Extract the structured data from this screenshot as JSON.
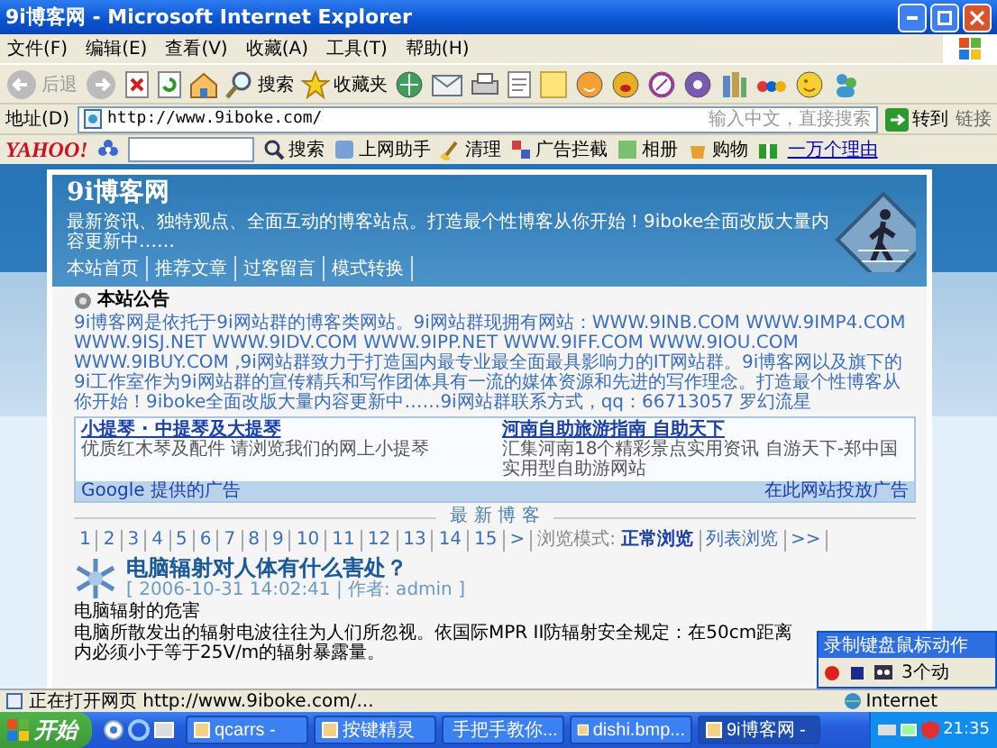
{
  "window": {
    "title": "9i博客网 - Microsoft Internet Explorer"
  },
  "menu": [
    "文件(F)",
    "编辑(E)",
    "查看(V)",
    "收藏(A)",
    "工具(T)",
    "帮助(H)"
  ],
  "toolbar": {
    "back": {
      "label": "后退",
      "disabled": true
    },
    "forward": {
      "disabled": true
    },
    "search": "搜索",
    "favorites": "收藏夹"
  },
  "address_bar": {
    "label": "地址(D)",
    "url": "http://www.9iboke.com/",
    "search_hint": "输入中文，直接搜索",
    "go": "转到",
    "links": "链接"
  },
  "yahoo_bar": {
    "logo": "YAHOO!",
    "search": "搜索",
    "items": [
      "上网助手",
      "清理",
      "广告拦截",
      "相册",
      "购物"
    ],
    "link": "一万个理由"
  },
  "page": {
    "site_title": "9i博客网",
    "slogan": "最新资讯、独特观点、全面互动的博客站点。打造最个性博客从你开始！9iboke全面改版大量内容更新中……",
    "nav": [
      "本站首页",
      "推荐文章",
      "过客留言",
      "模式转换"
    ],
    "notice": {
      "heading": "本站公告",
      "text": "9i博客网是依托于9i网站群的博客类网站。9i网站群现拥有网站：WWW.9INB.COM WWW.9IMP4.COM WWW.9ISJ.NET WWW.9IDV.COM WWW.9IPP.NET WWW.9IFF.COM WWW.9IOU.COM WWW.9IBUY.COM ,9i网站群致力于打造国内最专业最全面最具影响力的IT网站群。9i博客网以及旗下的9i工作室作为9i网站群的宣传精兵和写作团体具有一流的媒体资源和先进的写作理念。打造最个性博客从你开始！9iboke全面改版大量内容更新中……9i网站群联系方式，qq：66713057 罗幻流星"
    },
    "ads": [
      {
        "title": "小提琴 · 中提琴及大提琴",
        "text": "优质红木琴及配件 请浏览我们的网上小提琴"
      },
      {
        "title": "河南自助旅游指南 自助天下",
        "text": "汇集河南18个精彩景点实用资讯 自游天下-郑中国实用型自助游网站"
      }
    ],
    "ad_footer": {
      "left": "Google 提供的广告",
      "right": "在此网站投放广告"
    },
    "section_title": "最 新 博 客",
    "pagination": {
      "pages": [
        "1",
        "2",
        "3",
        "4",
        "5",
        "6",
        "7",
        "8",
        "9",
        "10",
        "11",
        "12",
        "13",
        "14",
        "15",
        ">"
      ],
      "mode_label": "浏览模式:",
      "modes": [
        {
          "label": "正常浏览",
          "selected": true
        },
        {
          "label": "列表浏览",
          "selected": false
        }
      ],
      "more": ">>"
    },
    "post": {
      "title": "电脑辐射对人体有什么害处？",
      "meta": "[ 2006-10-31 14:02:41 | 作者: admin ]",
      "subheading": "电脑辐射的危害",
      "text": "电脑所散发出的辐射电波往往为人们所忽视。依国际MPR II防辐射安全规定：在50cm距离内必须小于等于25V/m的辐射暴露量。"
    }
  },
  "recorder": {
    "title": "录制键盘鼠标动作",
    "note": "3个动"
  },
  "status_bar": {
    "text": "正在打开网页 http://www.9iboke.com/...",
    "zone": "Internet"
  },
  "taskbar": {
    "start": "开始",
    "tasks": [
      {
        "label": "qcarrs -",
        "selected": false
      },
      {
        "label": "按键精灵",
        "selected": false
      },
      {
        "label": "手把手教你...",
        "selected": false
      },
      {
        "label": "dishi.bmp...",
        "selected": false
      },
      {
        "label": "9i博客网 -",
        "selected": true
      }
    ],
    "clock": "21:35"
  }
}
